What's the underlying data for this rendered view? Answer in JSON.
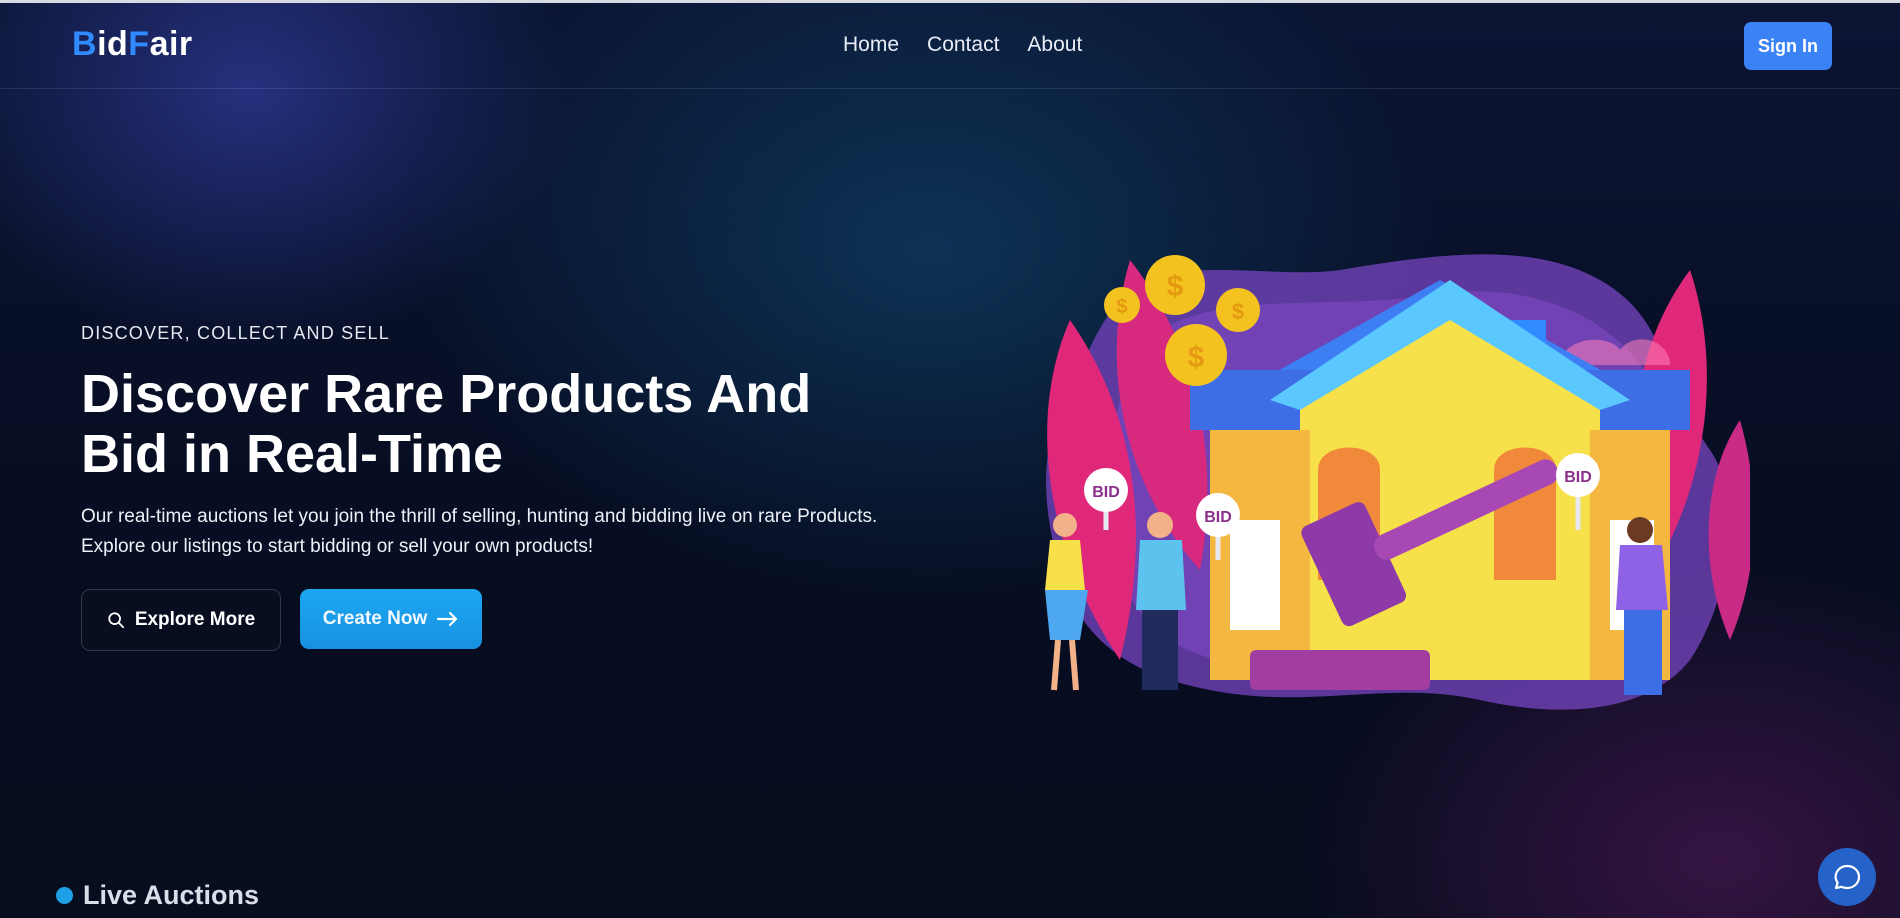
{
  "navbar": {
    "logo": {
      "part1": "B",
      "part2": "id",
      "part3": "F",
      "part4": "air"
    },
    "links": [
      "Home",
      "Contact",
      "About"
    ],
    "signin_label": "Sign In"
  },
  "hero": {
    "kicker": "DISCOVER, COLLECT AND SELL",
    "title_line1": "Discover Rare Products And",
    "title_line2": "Bid in Real-Time",
    "description_line1": "Our real-time auctions let you join the thrill of selling, hunting and bidding live on rare Products.",
    "description_line2": "Explore our listings to start bidding or sell your own products!",
    "explore_label": "Explore More",
    "explore_icon": "search-icon",
    "create_label": "Create Now",
    "create_icon": "arrow-right-icon"
  },
  "illustration": {
    "bid_sign_text": "BID",
    "coin_symbol": "$"
  },
  "live_auctions": {
    "title": "Live Auctions"
  },
  "chat": {
    "icon": "chat-bubble-icon"
  },
  "colors": {
    "accent_blue": "#3b82f6",
    "create_button": "#1ca7f2",
    "logo_accent": "#2f8bff",
    "background": "#070d22"
  }
}
